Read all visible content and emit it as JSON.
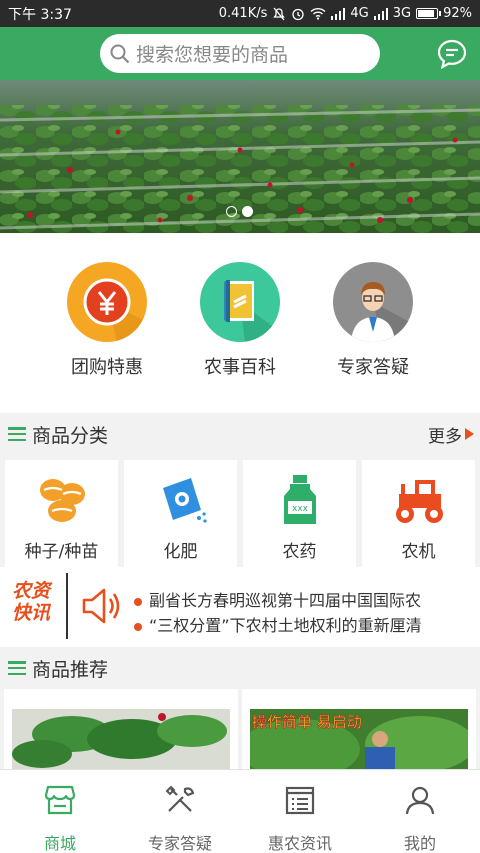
{
  "status_bar": {
    "time": "下午 3:37",
    "net_speed": "0.41K/s",
    "signal1": "4G",
    "signal2": "3G",
    "battery": "92%",
    "battery_level": 0.92
  },
  "header": {
    "search_placeholder": "搜索您想要的商品",
    "message_icon": "chat-bubble-icon",
    "accent_color": "#3aa962"
  },
  "banner": {
    "image": "strawberry-field-photo",
    "slide_count": 2,
    "active_slide": 2
  },
  "quick_links": [
    {
      "label": "团购特惠",
      "icon": "yuan-coin-icon",
      "color": "#f5a623"
    },
    {
      "label": "农事百科",
      "icon": "book-icon",
      "color": "#3cc89a"
    },
    {
      "label": "专家答疑",
      "icon": "expert-avatar-icon",
      "color": "#8e8e8e"
    }
  ],
  "category_section": {
    "title": "商品分类",
    "more": "更多"
  },
  "categories": [
    {
      "label": "种子/种苗",
      "icon": "seeds-icon"
    },
    {
      "label": "化肥",
      "icon": "fertilizer-bag-icon"
    },
    {
      "label": "农药",
      "icon": "pesticide-bottle-icon"
    },
    {
      "label": "农机",
      "icon": "tractor-icon"
    }
  ],
  "news": {
    "logo_line1": "农资",
    "logo_line2": "快讯",
    "items": [
      "副省长方春明巡视第十四届中国国际农",
      "“三权分置”下农村土地权利的重新厘清"
    ]
  },
  "recommend_section": {
    "title": "商品推荐"
  },
  "products": [
    {
      "image": "strawberry-plant-photo",
      "overlay_text": ""
    },
    {
      "image": "greenhouse-worker-photo",
      "overlay_text": "操作简单 易启动"
    }
  ],
  "bottom_nav": [
    {
      "label": "商城",
      "icon": "store-icon",
      "active": true
    },
    {
      "label": "专家答疑",
      "icon": "tools-icon",
      "active": false
    },
    {
      "label": "惠农资讯",
      "icon": "news-list-icon",
      "active": false
    },
    {
      "label": "我的",
      "icon": "user-icon",
      "active": false
    }
  ]
}
